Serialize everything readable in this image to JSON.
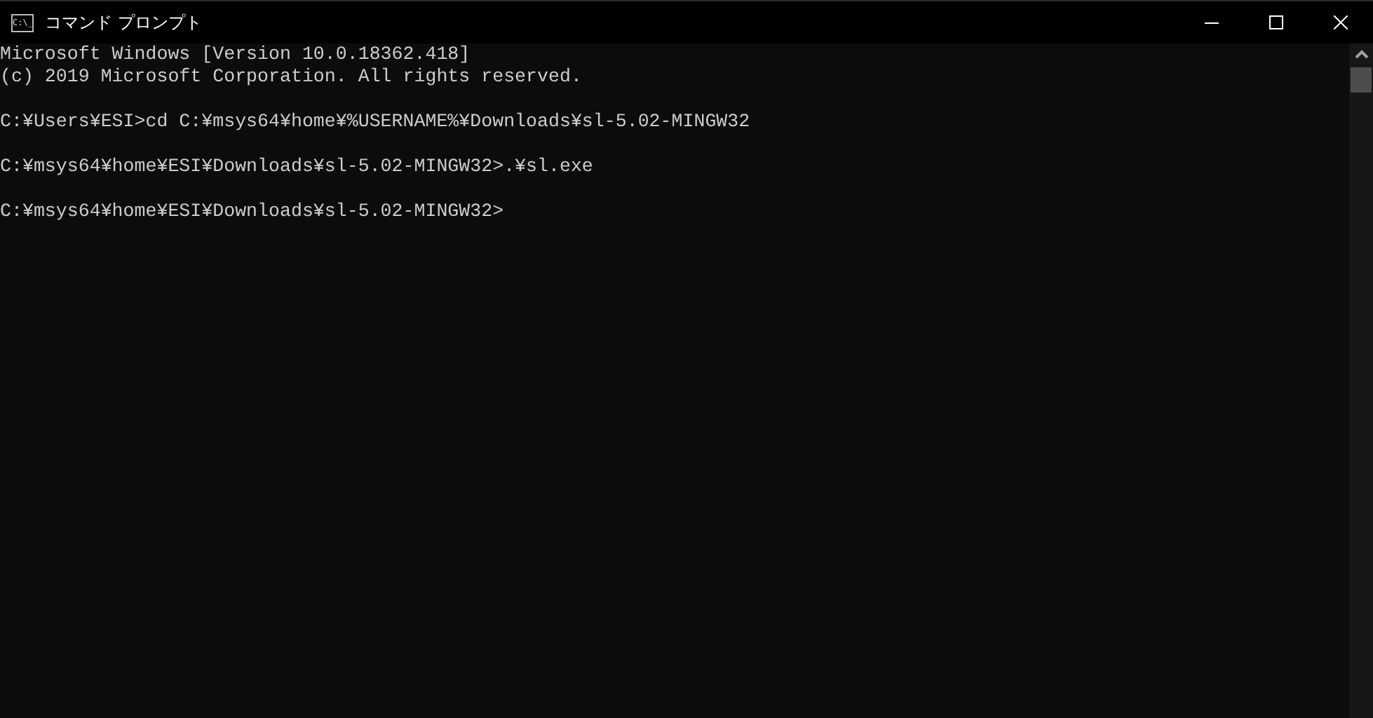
{
  "window": {
    "title": "コマンド プロンプト",
    "icon_text": "C:\\_"
  },
  "console": {
    "blocks": [
      [
        "Microsoft Windows [Version 10.0.18362.418]",
        "(c) 2019 Microsoft Corporation. All rights reserved."
      ],
      [
        "C:¥Users¥ESI>cd C:¥msys64¥home¥%USERNAME%¥Downloads¥sl-5.02-MINGW32"
      ],
      [
        "C:¥msys64¥home¥ESI¥Downloads¥sl-5.02-MINGW32>.¥sl.exe"
      ],
      [
        "C:¥msys64¥home¥ESI¥Downloads¥sl-5.02-MINGW32>"
      ]
    ]
  }
}
